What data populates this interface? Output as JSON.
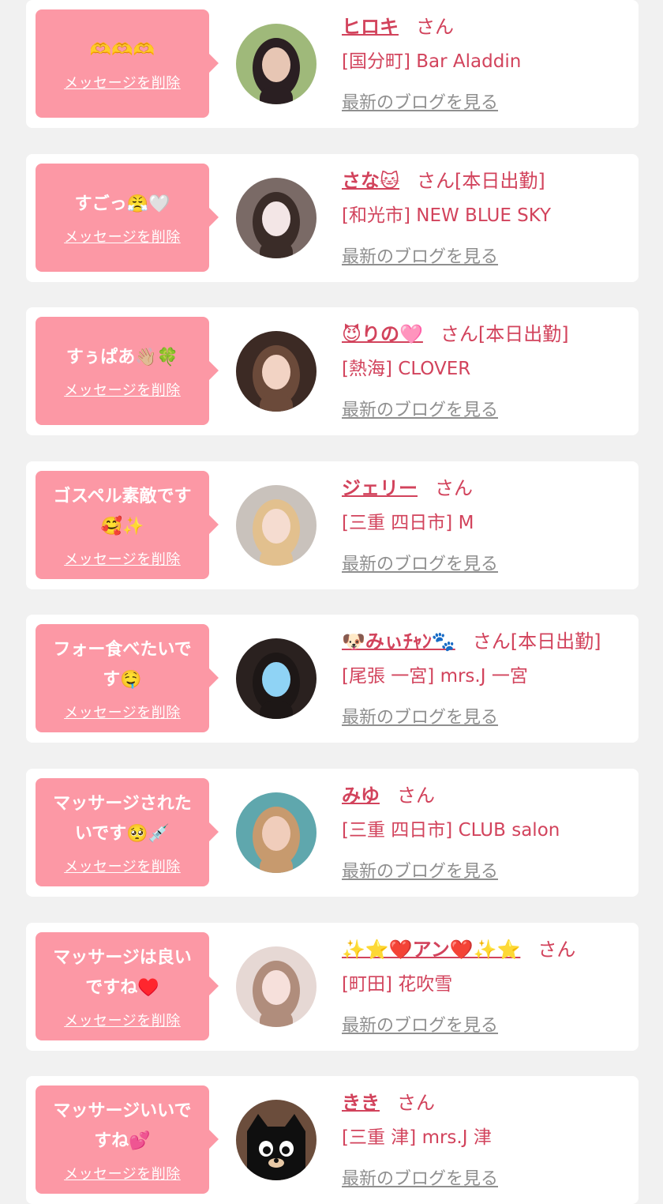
{
  "colors": {
    "page_bg": "#f1f1f1",
    "card_bg": "#ffffff",
    "bubble_bg": "#fc98a5",
    "accent": "#d2435c",
    "muted": "#8f8f8f"
  },
  "messages": [
    {
      "bubble_text": "🫶🫶🫶",
      "delete_label": "メッセージを削除",
      "name": "ヒロキ",
      "suffix": "さん",
      "shop": "[国分町] Bar Aladdin",
      "blog_label": "最新のブログを見る",
      "avatar": "woman-portrait-icon",
      "avatar_colors": [
        "#9fb97a",
        "#2a1f22",
        "#e7c6b4"
      ]
    },
    {
      "bubble_text": "すごっ😤🤍",
      "delete_label": "メッセージを削除",
      "name": "さな🐱",
      "suffix": "さん[本日出勤]",
      "shop": "[和光市] NEW BLUE SKY",
      "blog_label": "最新のブログを見る",
      "avatar": "woman-portrait-icon",
      "avatar_colors": [
        "#7a6a66",
        "#3a2c28",
        "#f3e6e6"
      ]
    },
    {
      "bubble_text": "すぅぱあ👋🏼🍀",
      "delete_label": "メッセージを削除",
      "name": "😈りの🩷",
      "suffix": "さん[本日出勤]",
      "shop": "[熱海] CLOVER",
      "blog_label": "最新のブログを見る",
      "avatar": "woman-portrait-icon",
      "avatar_colors": [
        "#3c2a24",
        "#6b4a3a",
        "#f2d3c4"
      ]
    },
    {
      "bubble_text": "ゴスペル素敵です🥰✨",
      "delete_label": "メッセージを削除",
      "name": "ジェリー",
      "suffix": "さん",
      "shop": "[三重 四日市] M",
      "blog_label": "最新のブログを見る",
      "avatar": "woman-portrait-icon",
      "avatar_colors": [
        "#c9c2bc",
        "#e2c08e",
        "#f5dcd0"
      ]
    },
    {
      "bubble_text": "フォー食べたいです🤤",
      "delete_label": "メッセージを削除",
      "name": "🐶みぃﾁｬﾝ🐾",
      "suffix": "さん[本日出勤]",
      "shop": "[尾張 一宮] mrs.J 一宮",
      "blog_label": "最新のブログを見る",
      "avatar": "woman-portrait-icon",
      "avatar_colors": [
        "#2a211f",
        "#1d1716",
        "#8fd3f5"
      ]
    },
    {
      "bubble_text": "マッサージされたいです🥺💉",
      "delete_label": "メッセージを削除",
      "name": "みゆ",
      "suffix": "さん",
      "shop": "[三重 四日市] CLUB salon",
      "blog_label": "最新のブログを見る",
      "avatar": "woman-portrait-icon",
      "avatar_colors": [
        "#5fa7ad",
        "#c79a6e",
        "#f0cdbb"
      ]
    },
    {
      "bubble_text": "マッサージは良いですね♥️",
      "delete_label": "メッセージを削除",
      "name": "✨⭐❤️アン❤️✨⭐",
      "suffix": "さん",
      "shop": "[町田] 花吹雪",
      "blog_label": "最新のブログを見る",
      "avatar": "woman-portrait-icon",
      "avatar_colors": [
        "#e6d8d4",
        "#b08d7c",
        "#f6e0db"
      ]
    },
    {
      "bubble_text": "マッサージいいですね💕",
      "delete_label": "メッセージを削除",
      "name": "きき",
      "suffix": "さん",
      "shop": "[三重 津] mrs.J 津",
      "blog_label": "最新のブログを見る",
      "avatar": "black-cat-icon",
      "avatar_colors": [
        "#6b4d3c",
        "#0f0f0f",
        "#ffffff"
      ]
    }
  ]
}
